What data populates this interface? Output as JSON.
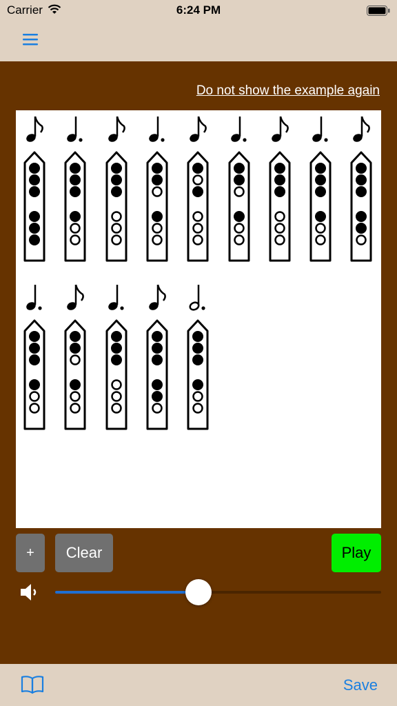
{
  "status_bar": {
    "carrier": "Carrier",
    "time": "6:24 PM"
  },
  "link_text": "Do not show the example again",
  "buttons": {
    "plus": "+",
    "clear": "Clear",
    "play": "Play"
  },
  "volume": {
    "level": 0.44
  },
  "tab_bar": {
    "save": "Save",
    "book_icon": "book-icon",
    "menu_icon": "hamburger-menu-icon"
  },
  "colors": {
    "background": "#663300",
    "bar": "#e0d2c2",
    "play": "#00ee00",
    "accent": "#1a7fe0"
  },
  "notes": [
    {
      "duration": "eighth",
      "holes": [
        1,
        1,
        1,
        1,
        1,
        1
      ]
    },
    {
      "duration": "dotted-quarter",
      "holes": [
        1,
        1,
        1,
        1,
        0,
        0
      ]
    },
    {
      "duration": "eighth",
      "holes": [
        1,
        1,
        1,
        0,
        0,
        0
      ]
    },
    {
      "duration": "dotted-quarter",
      "holes": [
        1,
        1,
        0,
        1,
        0,
        0
      ]
    },
    {
      "duration": "eighth",
      "holes": [
        1,
        0,
        1,
        0,
        0,
        0
      ]
    },
    {
      "duration": "dotted-quarter",
      "holes": [
        1,
        1,
        0,
        1,
        0,
        0
      ]
    },
    {
      "duration": "eighth",
      "holes": [
        1,
        1,
        1,
        0,
        0,
        0
      ]
    },
    {
      "duration": "dotted-quarter",
      "holes": [
        1,
        1,
        1,
        1,
        0,
        0
      ]
    },
    {
      "duration": "eighth",
      "holes": [
        1,
        1,
        1,
        1,
        1,
        0
      ]
    },
    {
      "duration": "dotted-quarter",
      "holes": [
        1,
        1,
        1,
        1,
        0,
        0
      ]
    },
    {
      "duration": "eighth",
      "holes": [
        1,
        1,
        0,
        1,
        0,
        0
      ]
    },
    {
      "duration": "dotted-quarter",
      "holes": [
        1,
        1,
        1,
        0,
        0,
        0
      ]
    },
    {
      "duration": "eighth",
      "holes": [
        1,
        1,
        1,
        1,
        1,
        0
      ]
    },
    {
      "duration": "dotted-half",
      "holes": [
        1,
        1,
        1,
        1,
        0,
        0
      ]
    }
  ]
}
